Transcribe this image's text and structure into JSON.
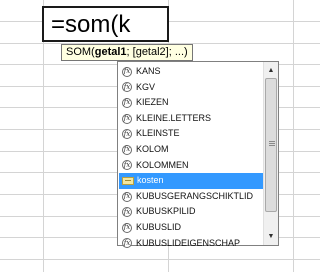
{
  "cell": {
    "formula_text": "=som(k"
  },
  "tooltip": {
    "func": "SOM(",
    "arg1": "getal1",
    "rest": "; [getal2]; ...)"
  },
  "autocomplete": {
    "items": [
      {
        "label": "KANS",
        "kind": "function",
        "icon": "function-icon"
      },
      {
        "label": "KGV",
        "kind": "function",
        "icon": "function-icon"
      },
      {
        "label": "KIEZEN",
        "kind": "function",
        "icon": "function-icon"
      },
      {
        "label": "KLEINE.LETTERS",
        "kind": "function",
        "icon": "function-icon"
      },
      {
        "label": "KLEINSTE",
        "kind": "function",
        "icon": "function-icon"
      },
      {
        "label": "KOLOM",
        "kind": "function",
        "icon": "function-icon"
      },
      {
        "label": "KOLOMMEN",
        "kind": "function",
        "icon": "function-icon"
      },
      {
        "label": "kosten",
        "kind": "named-range",
        "icon": "named-range-icon"
      },
      {
        "label": "KUBUSGERANGSCHIKTLID",
        "kind": "function",
        "icon": "function-icon"
      },
      {
        "label": "KUBUSKPILID",
        "kind": "function",
        "icon": "function-icon"
      },
      {
        "label": "KUBUSLID",
        "kind": "function",
        "icon": "function-icon"
      },
      {
        "label": "KUBUSLIDEIGENSCHAP",
        "kind": "function",
        "icon": "function-icon"
      }
    ],
    "selected_label": "kosten"
  },
  "colors": {
    "selection": "#3399ff",
    "tooltip_bg": "#ffffe1",
    "gridline": "#d4d4d4"
  }
}
